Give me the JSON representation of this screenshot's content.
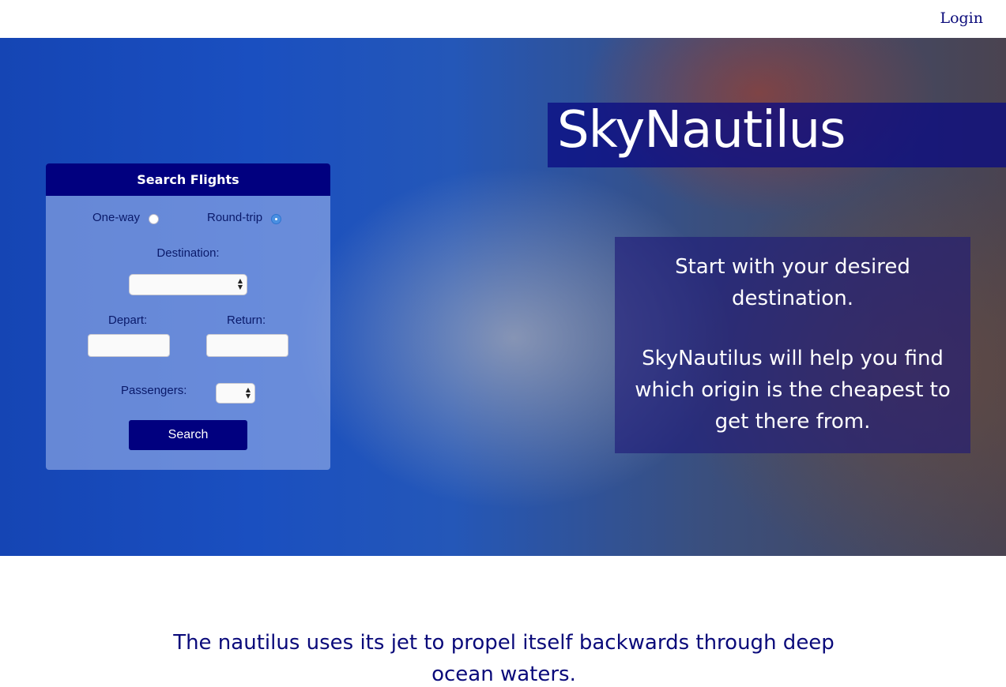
{
  "header": {
    "login_label": "Login"
  },
  "search_form": {
    "title": "Search Flights",
    "trip_types": [
      {
        "label": "One-way",
        "selected": false
      },
      {
        "label": "Round-trip",
        "selected": true
      }
    ],
    "destination_label": "Destination:",
    "destination_value": "",
    "depart_label": "Depart:",
    "depart_value": "",
    "return_label": "Return:",
    "return_value": "",
    "passengers_label": "Passengers:",
    "passengers_value": "",
    "search_label": "Search"
  },
  "hero": {
    "brand": "SkyNautilus",
    "info_lines": [
      "Start with your desired destination.",
      "SkyNautilus will help you find which origin is the cheapest to get there from."
    ]
  },
  "footer": {
    "tagline": "The nautilus uses its jet to propel itself backwards through deep ocean waters."
  },
  "colors": {
    "navy": "#01007f",
    "link": "#0a0a7a",
    "radio_selected": "#4a90e2"
  }
}
